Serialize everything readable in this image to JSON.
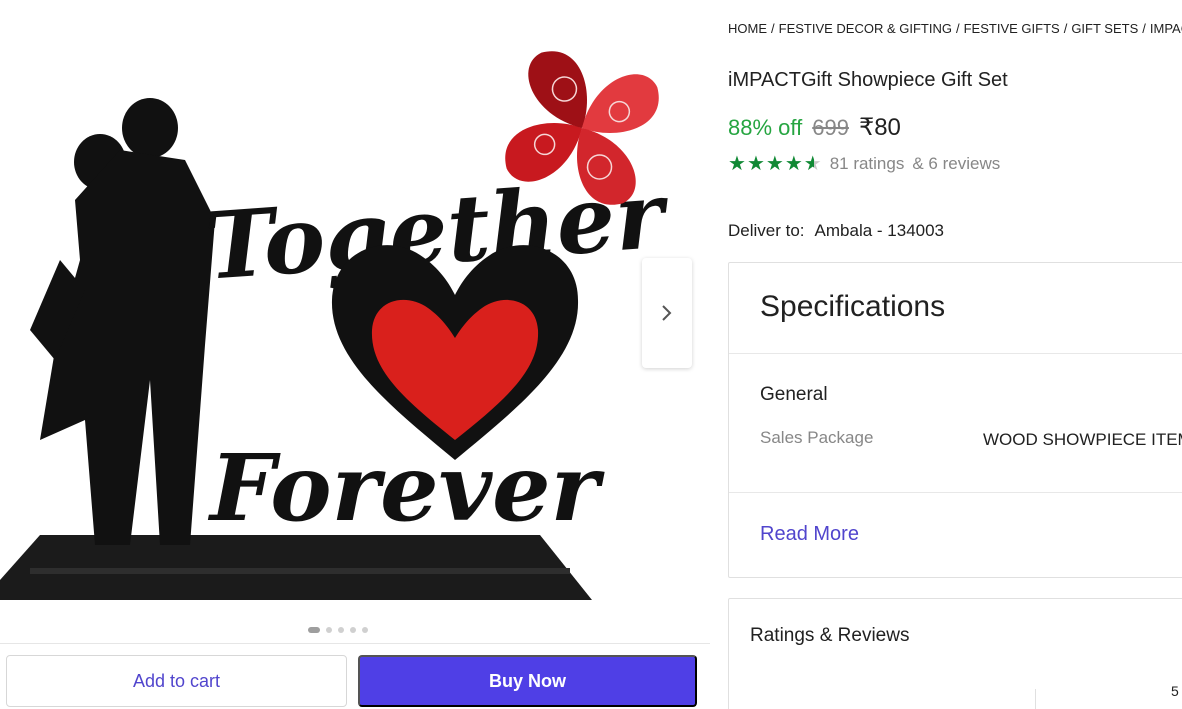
{
  "breadcrumb": [
    "HOME",
    "FESTIVE DECOR & GIFTING",
    "FESTIVE GIFTS",
    "GIFT SETS",
    "IMPACTG"
  ],
  "product": {
    "title": "iMPACTGift Showpiece Gift Set",
    "discount": "88% off",
    "mrp": "699",
    "price": "₹80",
    "rating_value": 4.5,
    "ratings_text": "81 ratings",
    "reviews_text": "& 6 reviews"
  },
  "image_text": {
    "line1": "Together",
    "line2": "Forever"
  },
  "gallery": {
    "image_count": 5,
    "active_index": 0
  },
  "delivery": {
    "label": "Deliver to:",
    "location": "Ambala - 134003"
  },
  "specifications": {
    "title": "Specifications",
    "section": "General",
    "rows": [
      {
        "key": "Sales Package",
        "value": "WOOD SHOWPIECE ITEM"
      }
    ],
    "read_more": "Read More"
  },
  "reviews": {
    "title": "Ratings & Reviews",
    "partial_number": "5"
  },
  "actions": {
    "add_to_cart": "Add to cart",
    "buy_now": "Buy Now"
  },
  "colors": {
    "primary": "#4f3fe6",
    "discount_green": "#26a541",
    "star_green": "#108934",
    "heart_red": "#d9201c"
  }
}
